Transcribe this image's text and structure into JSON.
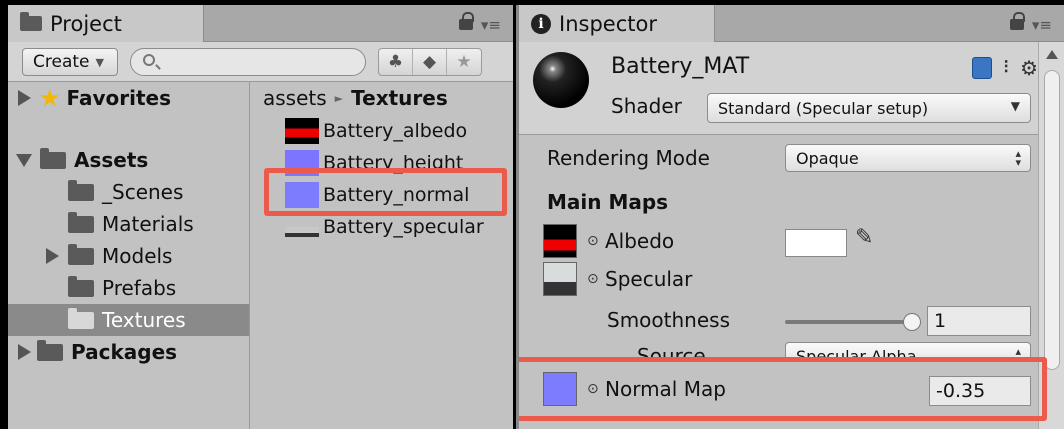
{
  "project": {
    "tab_title": "Project",
    "create_label": "Create",
    "search_placeholder": "",
    "tree": {
      "favorites": "Favorites",
      "assets": "Assets",
      "folders": [
        "_Scenes",
        "Materials",
        "Models",
        "Prefabs",
        "Textures"
      ],
      "packages": "Packages"
    },
    "breadcrumb": {
      "root": "assets",
      "current": "Textures"
    },
    "files": [
      "Battery_albedo",
      "Battery_height",
      "Battery_normal",
      "Battery_specular"
    ]
  },
  "inspector": {
    "tab_title": "Inspector",
    "material_name": "Battery_MAT",
    "shader_label": "Shader",
    "shader_value": "Standard (Specular setup)",
    "rendering_mode_label": "Rendering Mode",
    "rendering_mode_value": "Opaque",
    "main_maps_label": "Main Maps",
    "albedo_label": "Albedo",
    "specular_label": "Specular",
    "smoothness_label": "Smoothness",
    "smoothness_value": "1",
    "source_label": "Source",
    "source_value": "Specular Alpha",
    "normal_map_label": "Normal Map",
    "normal_map_value": "-0.35"
  },
  "colors": {
    "highlight": "#ec5a4c",
    "normal_map": "#7d7cff",
    "selection": "#8a8a8a"
  },
  "icons": [
    "folder-icon",
    "info-icon",
    "lock-icon",
    "menu-icon",
    "search-icon",
    "star-icon",
    "book-icon",
    "gear-icon",
    "eyedropper-icon"
  ]
}
